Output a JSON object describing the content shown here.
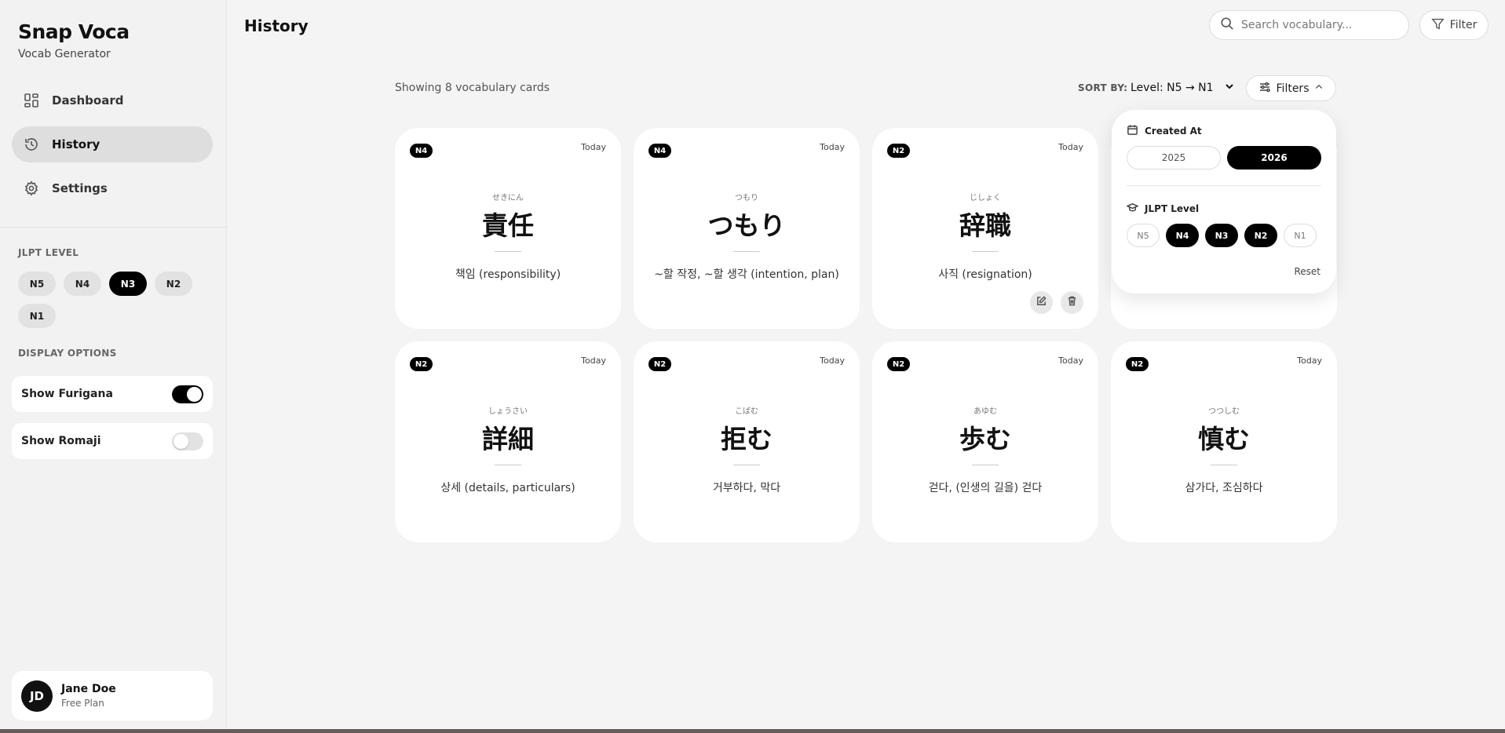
{
  "brand": {
    "title": "Snap Voca",
    "subtitle": "Vocab Generator"
  },
  "nav": [
    {
      "label": "Dashboard",
      "icon": "dashboard-icon",
      "active": false
    },
    {
      "label": "History",
      "icon": "history-icon",
      "active": true
    },
    {
      "label": "Settings",
      "icon": "gear-icon",
      "active": false
    }
  ],
  "sidebar": {
    "jlpt_title": "JLPT LEVEL",
    "levels": [
      {
        "label": "N5",
        "selected": false
      },
      {
        "label": "N4",
        "selected": false
      },
      {
        "label": "N3",
        "selected": true
      },
      {
        "label": "N2",
        "selected": false
      },
      {
        "label": "N1",
        "selected": false
      }
    ],
    "display_title": "DISPLAY OPTIONS",
    "toggles": [
      {
        "label": "Show Furigana",
        "on": true
      },
      {
        "label": "Show Romaji",
        "on": false
      }
    ]
  },
  "user": {
    "initials": "JD",
    "name": "Jane Doe",
    "plan": "Free Plan"
  },
  "header": {
    "title": "History",
    "search_placeholder": "Search vocabulary...",
    "filter_label": "Filter"
  },
  "toolbar": {
    "count_text": "Showing 8 vocabulary cards",
    "sort_label": "SORT BY:",
    "sort_value": "Level: N5 → N1",
    "filters_label": "Filters"
  },
  "cards": [
    {
      "level": "N4",
      "date": "Today",
      "furigana": "せきにん",
      "word": "責任",
      "meaning": "책임 (responsibility)"
    },
    {
      "level": "N4",
      "date": "Today",
      "furigana": "つもり",
      "word": "つもり",
      "meaning": "~할 작정, ~할 생각 (intention, plan)"
    },
    {
      "level": "N2",
      "date": "Today",
      "furigana": "じしょく",
      "word": "辞職",
      "meaning": "사직 (resignation)"
    },
    {
      "level": "N2",
      "date": "Today",
      "furigana": "しょうさい",
      "word": "詳細",
      "meaning": "상세 (details, particulars)"
    },
    {
      "level": "N2",
      "date": "Today",
      "furigana": "こばむ",
      "word": "拒む",
      "meaning": "거부하다, 막다"
    },
    {
      "level": "N2",
      "date": "Today",
      "furigana": "あゆむ",
      "word": "歩む",
      "meaning": "걷다, (인생의 길을) 걷다"
    },
    {
      "level": "N2",
      "date": "Today",
      "furigana": "つつしむ",
      "word": "慎む",
      "meaning": "삼가다, 조심하다"
    }
  ],
  "popover": {
    "created_title": "Created At",
    "years": [
      {
        "label": "2025",
        "selected": false
      },
      {
        "label": "2026",
        "selected": true
      }
    ],
    "jlpt_title": "JLPT Level",
    "levels": [
      {
        "label": "N5",
        "selected": false
      },
      {
        "label": "N4",
        "selected": true
      },
      {
        "label": "N3",
        "selected": true
      },
      {
        "label": "N2",
        "selected": true
      },
      {
        "label": "N1",
        "selected": false
      }
    ],
    "reset_label": "Reset"
  }
}
